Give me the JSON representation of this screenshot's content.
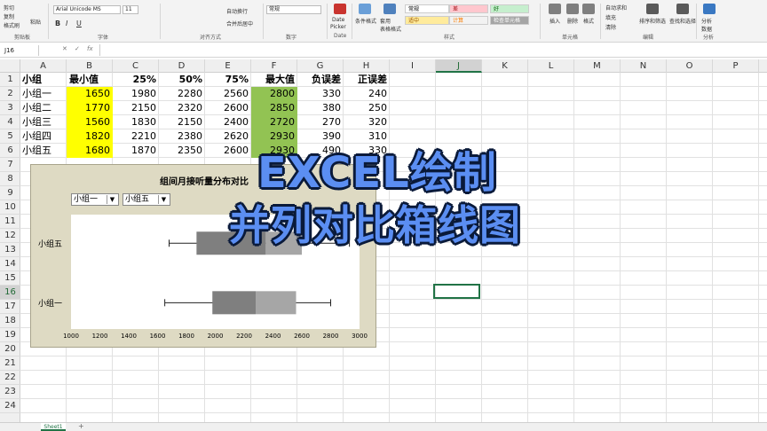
{
  "ribbon": {
    "clipboard": {
      "cut": "剪切",
      "copy": "复制",
      "paste": "粘贴",
      "format_painter": "格式刷",
      "label": "剪贴板"
    },
    "font": {
      "name": "Arial Unicode MS",
      "size": "11",
      "label": "字体"
    },
    "alignment": {
      "wrap": "自动换行",
      "merge": "合并后居中",
      "label": "对齐方式"
    },
    "number": {
      "format": "常规",
      "label": "数字"
    },
    "date_picker": {
      "line1": "Date",
      "line2": "Picker",
      "label": "Date"
    },
    "styles": {
      "cond_format": "条件格式",
      "table_format": "套用\n表格格式",
      "label": "样式",
      "cells": [
        {
          "text": "常规",
          "bg": "#ffffff",
          "fg": "#000000"
        },
        {
          "text": "差",
          "bg": "#ffc7ce",
          "fg": "#9c0006"
        },
        {
          "text": "好",
          "bg": "#c6efce",
          "fg": "#006100"
        },
        {
          "text": "适中",
          "bg": "#ffeb9c",
          "fg": "#9c5700"
        },
        {
          "text": "计算",
          "bg": "#f2f2f2",
          "fg": "#fa7d00"
        },
        {
          "text": "检查单元格",
          "bg": "#a5a5a5",
          "fg": "#ffffff"
        }
      ]
    },
    "cells_group": {
      "insert": "插入",
      "delete": "删除",
      "format": "格式",
      "label": "单元格"
    },
    "editing": {
      "autosum": "自动求和",
      "fill": "填充",
      "clear": "清除",
      "sort": "排序和筛选",
      "find": "查找和选择",
      "label": "编辑"
    },
    "analysis": {
      "analyze": "分析\n数据",
      "label": "分析"
    }
  },
  "formula_bar": {
    "name_box": "J16",
    "fx": "fx"
  },
  "columns": [
    "A",
    "B",
    "C",
    "D",
    "E",
    "F",
    "G",
    "H",
    "I",
    "J",
    "K",
    "L",
    "M",
    "N",
    "O",
    "P"
  ],
  "active_column": "J",
  "active_row": "16",
  "rows": [
    "1",
    "2",
    "3",
    "4",
    "5",
    "6",
    "7",
    "8",
    "9",
    "10",
    "11",
    "12",
    "13",
    "14",
    "15",
    "16",
    "17",
    "18",
    "19",
    "20",
    "21",
    "22",
    "23",
    "24"
  ],
  "table": {
    "headers": [
      "小组",
      "最小值",
      "25%",
      "50%",
      "75%",
      "最大值",
      "负误差",
      "正误差"
    ],
    "rows": [
      [
        "小组一",
        "1650",
        "1980",
        "2280",
        "2560",
        "2800",
        "330",
        "240"
      ],
      [
        "小组二",
        "1770",
        "2150",
        "2320",
        "2600",
        "2850",
        "380",
        "250"
      ],
      [
        "小组三",
        "1560",
        "1830",
        "2150",
        "2400",
        "2720",
        "270",
        "320"
      ],
      [
        "小组四",
        "1820",
        "2210",
        "2380",
        "2620",
        "2930",
        "390",
        "310"
      ],
      [
        "小组五",
        "1680",
        "1870",
        "2350",
        "2600",
        "2930",
        "490",
        "330"
      ]
    ],
    "highlight_min_color": "#ffff00",
    "highlight_max_color": "#92c353"
  },
  "chart": {
    "title": "组间月接听量分布对比",
    "dropdown1": "小组一",
    "dropdown2": "小组五",
    "frame_color": "#dedac3",
    "chart_data": {
      "type": "box",
      "categories": [
        "小组五",
        "小组一"
      ],
      "series": [
        {
          "name": "小组五",
          "min": 1680,
          "q1": 1870,
          "median": 2350,
          "q3": 2600,
          "max": 2930
        },
        {
          "name": "小组一",
          "min": 1650,
          "q1": 1980,
          "median": 2280,
          "q3": 2560,
          "max": 2800
        }
      ],
      "xlim": [
        1000,
        3000
      ],
      "xticks": [
        "1000",
        "1200",
        "1400",
        "1600",
        "1800",
        "2000",
        "2200",
        "2400",
        "2600",
        "2800",
        "3000"
      ],
      "box_colors": [
        "#7f7f7f",
        "#a6a6a6"
      ]
    }
  },
  "overlay": {
    "line1": "EXCEL绘制",
    "line2": "并列对比箱线图"
  },
  "sheet_tab": "Sheet1"
}
